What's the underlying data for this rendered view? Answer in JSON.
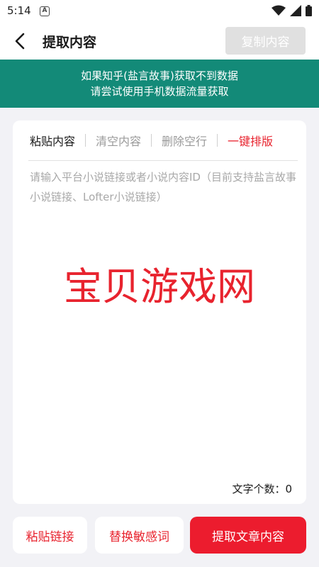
{
  "status_bar": {
    "time": "5:14",
    "notif_letter": "A"
  },
  "header": {
    "title": "提取内容",
    "copy_button": "复制内容"
  },
  "notice": {
    "line1": "如果知乎(盐言故事)获取不到数据",
    "line2": "请尝试使用手机数据流量获取"
  },
  "tabs": [
    {
      "label": "粘贴内容"
    },
    {
      "label": "清空内容"
    },
    {
      "label": "删除空行"
    },
    {
      "label": "一键排版"
    }
  ],
  "editor": {
    "value": "",
    "placeholder": "请输入平台小说链接或者小说内容ID（目前支持盐言故事小说链接、Lofter小说链接）",
    "watermark": "宝贝游戏网"
  },
  "counter": {
    "label": "文字个数：",
    "value": "0"
  },
  "actions": {
    "paste_link": "粘贴链接",
    "replace_words": "替换敏感词",
    "extract": "提取文章内容"
  },
  "colors": {
    "accent": "#e8232e",
    "notice_bg": "#138a78",
    "primary_button": "#ec1c2e"
  },
  "icons": {
    "back": "chevron-left-icon",
    "wifi": "wifi-icon",
    "signal": "signal-icon",
    "battery": "battery-icon"
  }
}
